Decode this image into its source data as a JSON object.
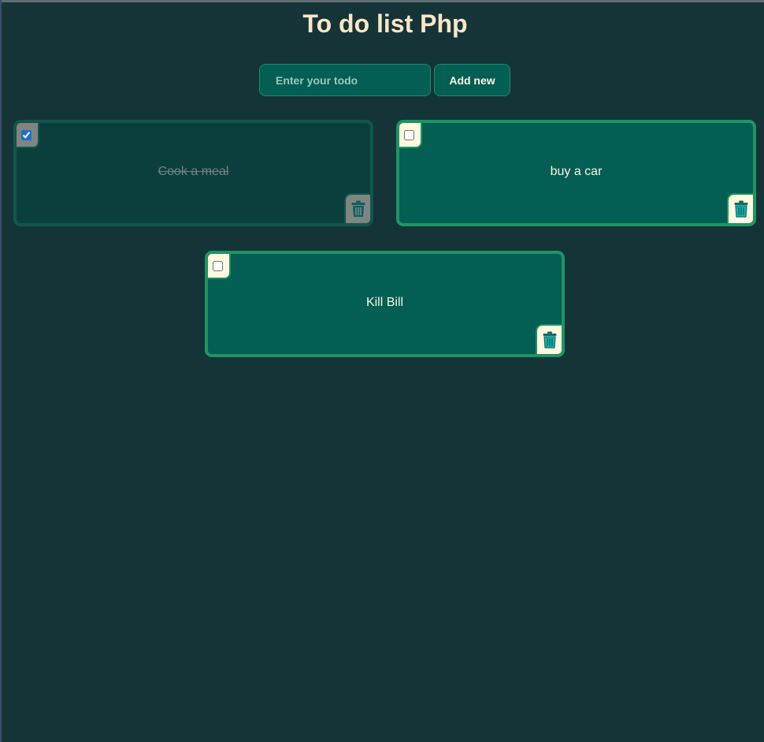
{
  "header": {
    "title": "To do list Php"
  },
  "form": {
    "placeholder": "Enter your todo",
    "value": "",
    "add_label": "Add new"
  },
  "colors": {
    "background": "#143438",
    "card": "#035e53",
    "card_done": "#0b3f3e",
    "border": "#1f9465",
    "title": "#fde6c6",
    "trash_active": "#13b5b0",
    "trash_done": "#0b6060"
  },
  "todos": [
    {
      "text": "Cook a meal",
      "done": true,
      "icon": "trash-icon"
    },
    {
      "text": "buy a car",
      "done": false,
      "icon": "trash-icon"
    },
    {
      "text": "Kill Bill",
      "done": false,
      "icon": "trash-icon"
    }
  ]
}
